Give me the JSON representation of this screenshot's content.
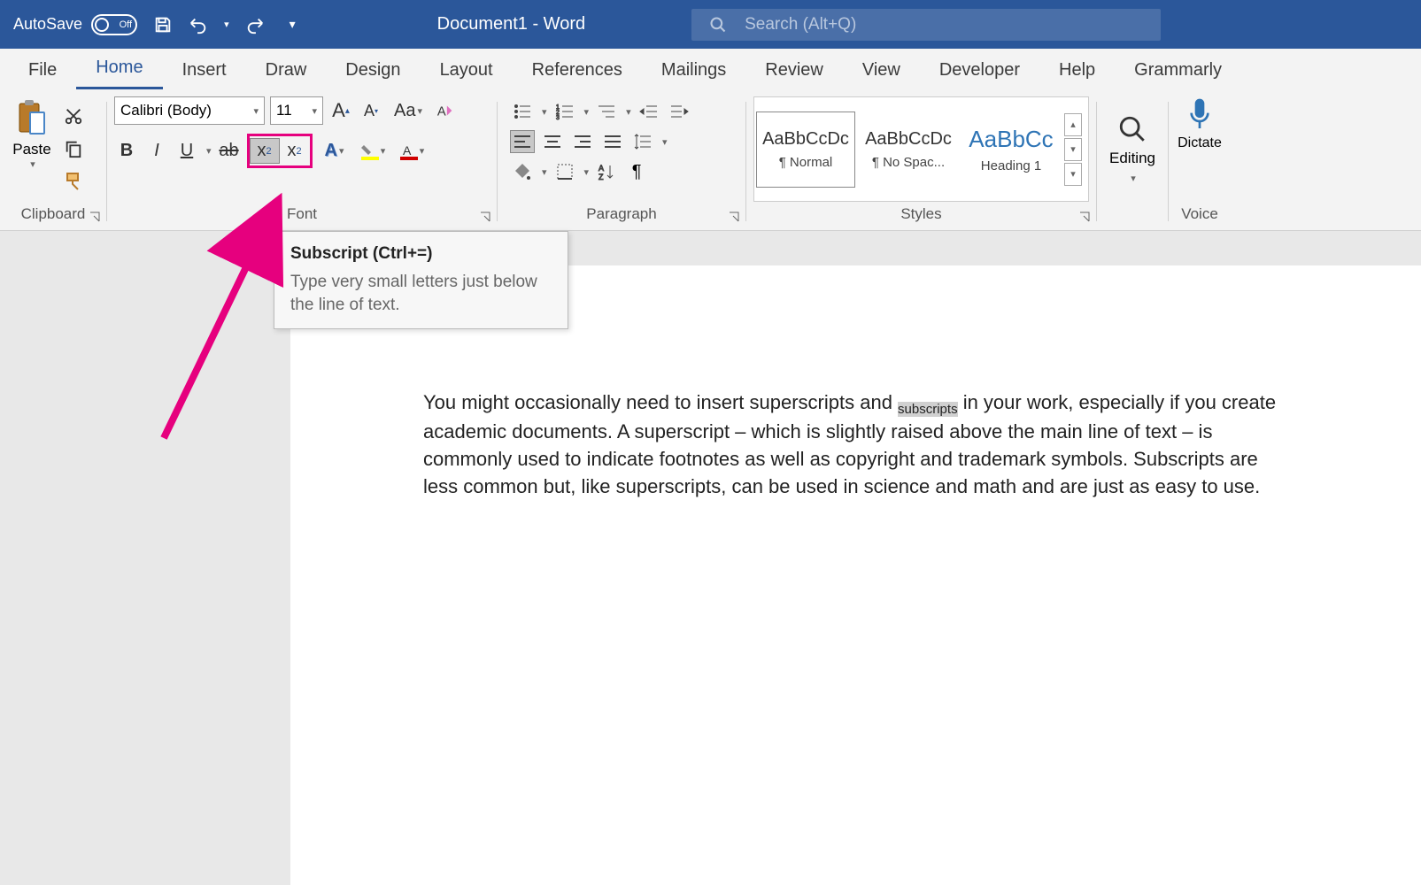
{
  "titlebar": {
    "autosave_label": "AutoSave",
    "toggle_state": "Off",
    "document_title": "Document1  -  Word",
    "search_placeholder": "Search (Alt+Q)"
  },
  "tabs": {
    "file": "File",
    "home": "Home",
    "insert": "Insert",
    "draw": "Draw",
    "design": "Design",
    "layout": "Layout",
    "references": "References",
    "mailings": "Mailings",
    "review": "Review",
    "view": "View",
    "developer": "Developer",
    "help": "Help",
    "grammarly": "Grammarly"
  },
  "ribbon": {
    "clipboard": {
      "paste": "Paste",
      "label": "Clipboard"
    },
    "font": {
      "name": "Calibri (Body)",
      "size": "11",
      "case_label": "Aa",
      "label": "Font"
    },
    "paragraph": {
      "label": "Paragraph"
    },
    "styles": {
      "label": "Styles",
      "items": [
        {
          "preview": "AaBbCcDc",
          "name": "¶ Normal"
        },
        {
          "preview": "AaBbCcDc",
          "name": "¶ No Spac..."
        },
        {
          "preview": "AaBbCc",
          "name": "Heading 1"
        }
      ]
    },
    "editing": {
      "label": "Editing"
    },
    "voice": {
      "dictate": "Dictate",
      "label": "Voice"
    }
  },
  "tooltip": {
    "title": "Subscript (Ctrl+=)",
    "body": "Type very small letters just below the line of text."
  },
  "document": {
    "para_before": "You might occasionally need to insert superscripts and ",
    "subscripted_word": "subscripts",
    "para_after": " in your work, especially if you create academic documents. A superscript – which is slightly raised above the main line of text – is commonly used to indicate footnotes as well as copyright and trademark symbols. Subscripts are less common but, like superscripts, can be used in science and math and are just as easy to use."
  }
}
